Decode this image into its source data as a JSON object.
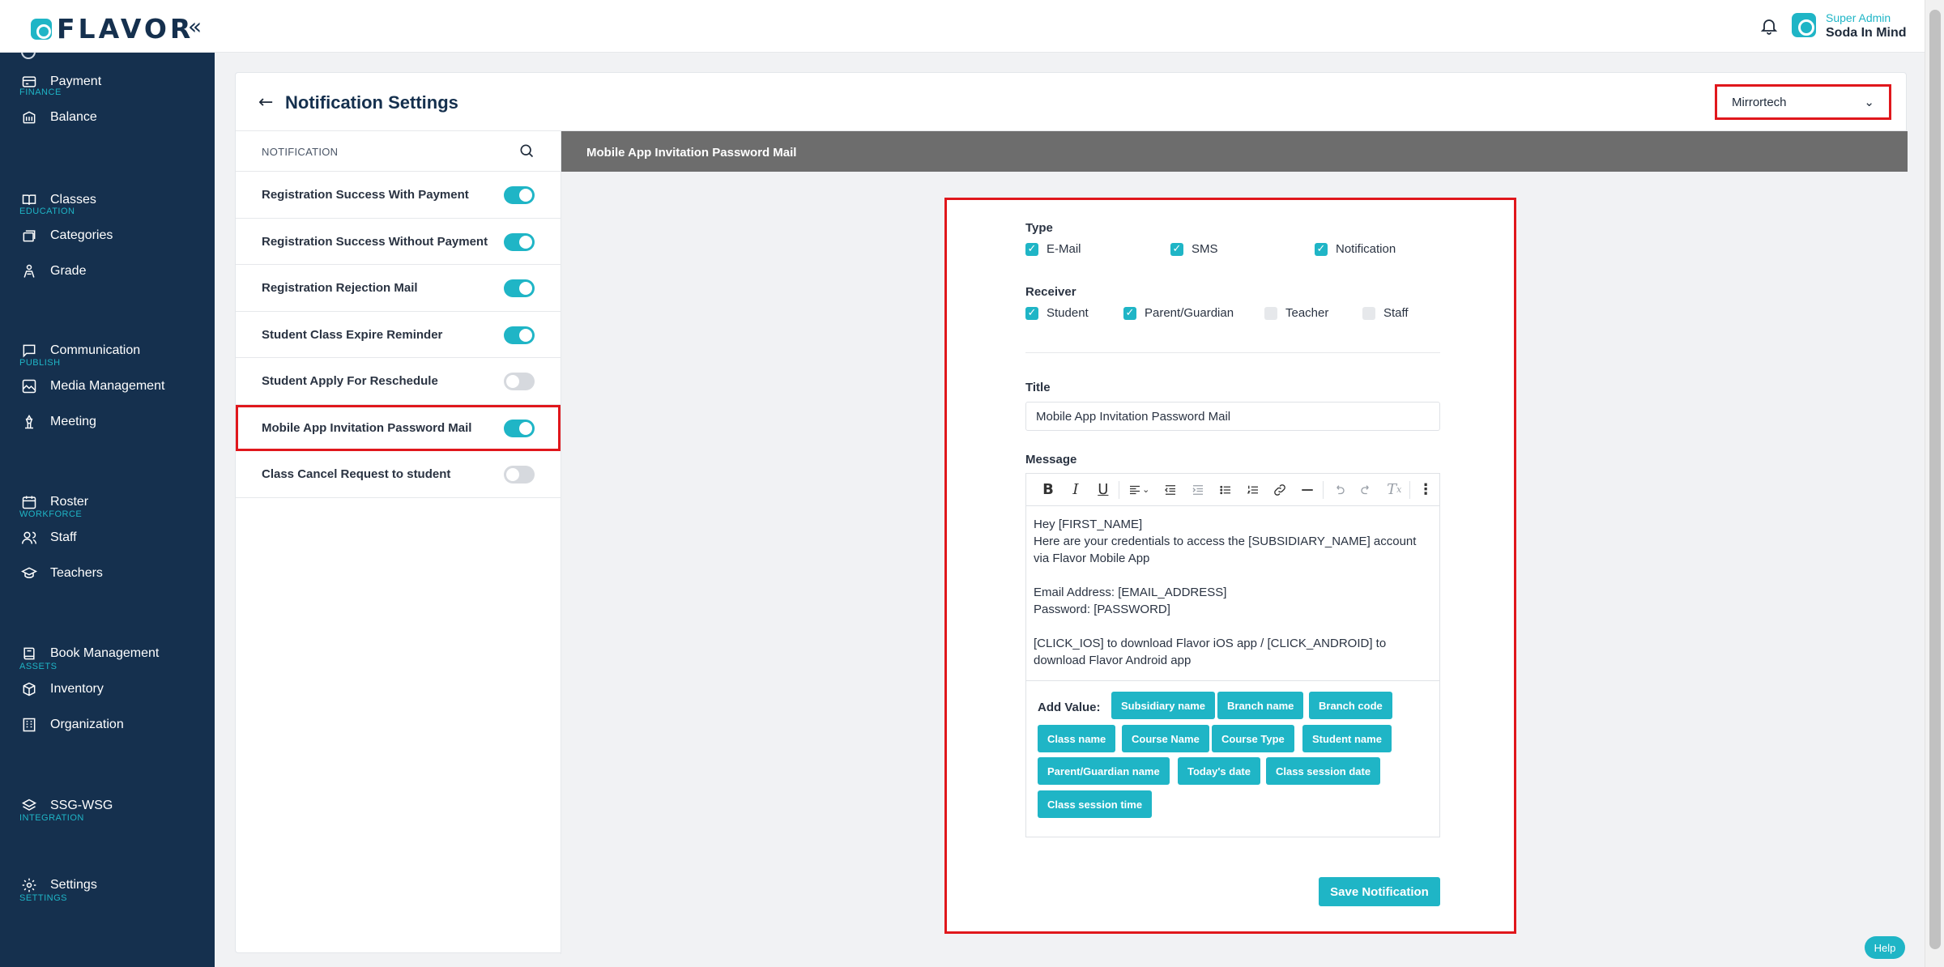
{
  "brand": {
    "name": "FLAVOR",
    "collapse_glyph": "«"
  },
  "user": {
    "role": "Super Admin",
    "name": "Soda In Mind"
  },
  "sidebar": {
    "sections": [
      {
        "title": "FINANCE",
        "items": [
          {
            "label": "Payment",
            "icon": "payment-card-icon"
          },
          {
            "label": "Balance",
            "icon": "balance-icon"
          }
        ]
      },
      {
        "title": "EDUCATION",
        "items": [
          {
            "label": "Classes",
            "icon": "book-open-icon"
          },
          {
            "label": "Categories",
            "icon": "categories-icon"
          },
          {
            "label": "Grade",
            "icon": "grade-icon"
          }
        ]
      },
      {
        "title": "PUBLISH",
        "items": [
          {
            "label": "Communication",
            "icon": "chat-icon"
          },
          {
            "label": "Media Management",
            "icon": "media-icon"
          },
          {
            "label": "Meeting",
            "icon": "meeting-icon"
          }
        ]
      },
      {
        "title": "WORKFORCE",
        "items": [
          {
            "label": "Roster",
            "icon": "calendar-icon"
          },
          {
            "label": "Staff",
            "icon": "staff-icon"
          },
          {
            "label": "Teachers",
            "icon": "teacher-cap-icon"
          }
        ]
      },
      {
        "title": "ASSETS",
        "items": [
          {
            "label": "Book Management",
            "icon": "book-icon"
          },
          {
            "label": "Inventory",
            "icon": "inventory-icon"
          },
          {
            "label": "Organization",
            "icon": "building-icon"
          }
        ]
      },
      {
        "title": "INTEGRATION",
        "items": [
          {
            "label": "SSG-WSG",
            "icon": "layers-icon"
          }
        ]
      },
      {
        "title": "SETTINGS",
        "items": [
          {
            "label": "Settings",
            "icon": "gear-icon"
          }
        ]
      }
    ]
  },
  "page": {
    "title": "Notification Settings",
    "subsidiary": "Mirrortech"
  },
  "notifications": {
    "header": "NOTIFICATION",
    "items": [
      {
        "label": "Registration Success With Payment",
        "enabled": true
      },
      {
        "label": "Registration Success Without Payment",
        "enabled": true
      },
      {
        "label": "Registration Rejection Mail",
        "enabled": true
      },
      {
        "label": "Student Class Expire Reminder",
        "enabled": true
      },
      {
        "label": "Student Apply For Reschedule",
        "enabled": false
      },
      {
        "label": "Mobile App Invitation Password Mail",
        "enabled": true,
        "selected": true
      },
      {
        "label": "Class Cancel Request to student",
        "enabled": false
      }
    ]
  },
  "detail": {
    "header": "Mobile App Invitation Password Mail",
    "type_label": "Type",
    "types": [
      {
        "label": "E-Mail",
        "checked": true
      },
      {
        "label": "SMS",
        "checked": true
      },
      {
        "label": "Notification",
        "checked": true
      }
    ],
    "receiver_label": "Receiver",
    "receivers": [
      {
        "label": "Student",
        "checked": true
      },
      {
        "label": "Parent/Guardian",
        "checked": true
      },
      {
        "label": "Teacher",
        "checked": false
      },
      {
        "label": "Staff",
        "checked": false
      }
    ],
    "title_label": "Title",
    "title_value": "Mobile App Invitation Password Mail",
    "message_label": "Message",
    "message_lines": [
      "Hey [FIRST_NAME]",
      "Here are your credentials to access the [SUBSIDIARY_NAME] account via Flavor Mobile App",
      "",
      "Email Address: [EMAIL_ADDRESS]",
      "Password: [PASSWORD]",
      "",
      "[CLICK_IOS] to download Flavor iOS app / [CLICK_ANDROID] to download Flavor Android app"
    ],
    "add_value_label": "Add Value:",
    "chips": [
      "Subsidiary name",
      "Branch name",
      "Branch code",
      "Class name",
      "Course Name",
      "Course Type",
      "Student name",
      "Parent/Guardian name",
      "Today's date",
      "Class session date",
      "Class session time"
    ],
    "save_label": "Save Notification"
  },
  "help_label": "Help",
  "colors": {
    "accent": "#1fb5c6",
    "sidebar": "#15304e",
    "highlight": "#e0171c",
    "detail_header": "#6d6d6d"
  }
}
